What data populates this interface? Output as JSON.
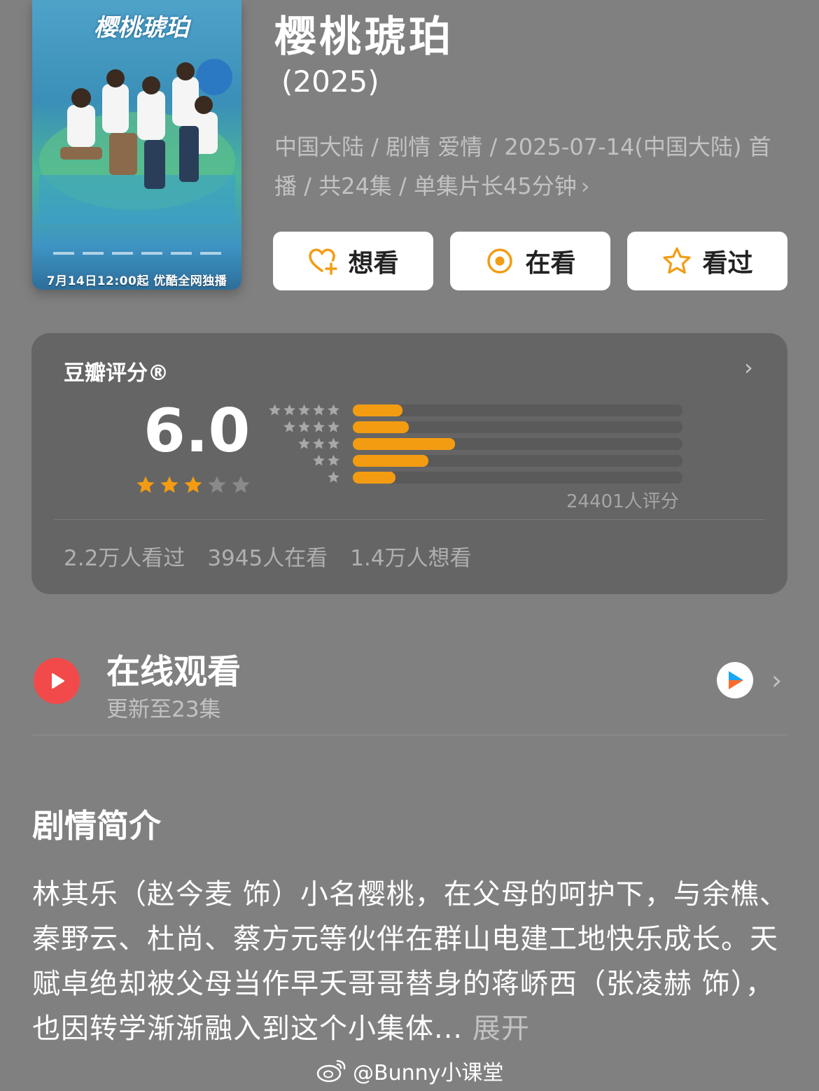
{
  "poster": {
    "title_art": "樱桃琥珀",
    "banner": "7月14日12:00起 优酷全网独播"
  },
  "show": {
    "title": "樱桃琥珀",
    "year": "(2025)",
    "meta": "中国大陆 / 剧情 爱情 / 2025-07-14(中国大陆) 首播 / 共24集 / 单集片长45分钟"
  },
  "actions": {
    "want": "想看",
    "watching": "在看",
    "watched": "看过"
  },
  "rating": {
    "label": "豆瓣评分®",
    "score": "6.0",
    "stars_filled": 3,
    "stars_total": 5,
    "distribution": [
      {
        "stars": 5,
        "fraction": 0.15
      },
      {
        "stars": 4,
        "fraction": 0.17
      },
      {
        "stars": 3,
        "fraction": 0.31
      },
      {
        "stars": 2,
        "fraction": 0.23
      },
      {
        "stars": 1,
        "fraction": 0.13
      }
    ],
    "votes": "24401人评分",
    "watched": "2.2万人看过",
    "watching": "3945人在看",
    "want": "1.4万人想看"
  },
  "online": {
    "title": "在线观看",
    "subtitle": "更新至23集"
  },
  "synopsis": {
    "heading": "剧情简介",
    "text": "林其乐（赵今麦 饰）小名樱桃，在父母的呵护下，与余樵、秦野云、杜尚、蔡方元等伙伴在群山电建工地快乐成长。天赋卓绝却被父母当作早夭哥哥替身的蒋峤西（张凌赫 饰），也因转学渐渐融入到这个小集体...",
    "expand": "展开"
  },
  "watermark": "@Bunny小课堂",
  "colors": {
    "accent_orange": "#f39c12",
    "play_red": "#f24a4a",
    "background": "#808080",
    "card": "#656565"
  }
}
